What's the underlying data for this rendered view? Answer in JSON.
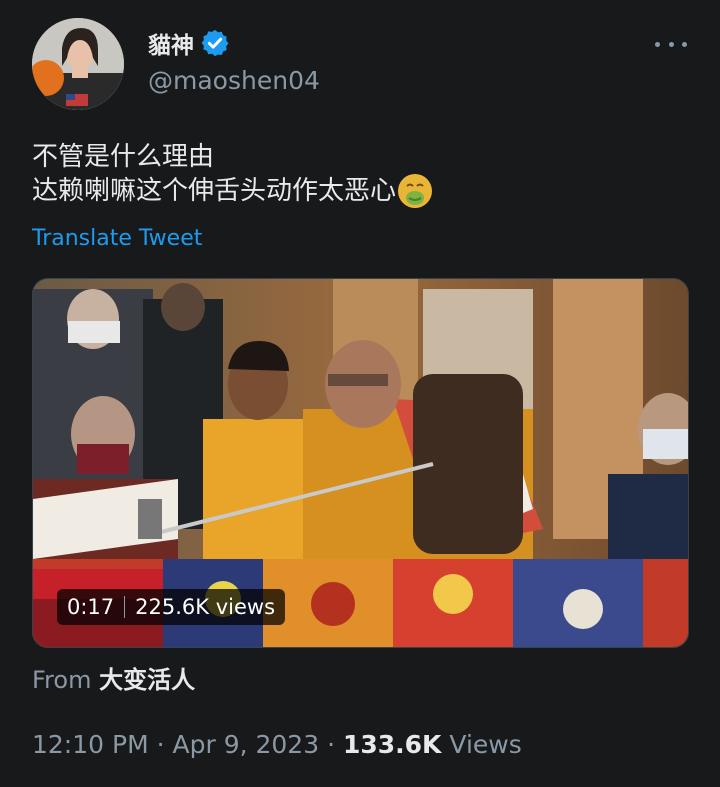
{
  "author": {
    "display_name": "貓神",
    "handle": "@maoshen04",
    "avatar_icon": "profile-photo",
    "verified_icon": "verified-badge-icon"
  },
  "tweet": {
    "line1": "不管是什么理由",
    "line2": "达赖喇嘛这个伸舌头动作太恶心",
    "emoji": "nauseated-face-icon"
  },
  "translate_label": "Translate Tweet",
  "video": {
    "duration": "0:17",
    "views": "225.6K views"
  },
  "from": {
    "prefix": "From",
    "source": "大变活人"
  },
  "meta": {
    "time": "12:10 PM",
    "separator": "·",
    "date": "Apr 9, 2023",
    "view_count": "133.6K",
    "views_label": "Views"
  },
  "colors": {
    "background": "#17191a",
    "text": "#e7e9ea",
    "secondary": "#8b98a5",
    "link": "#1d9bf0"
  }
}
